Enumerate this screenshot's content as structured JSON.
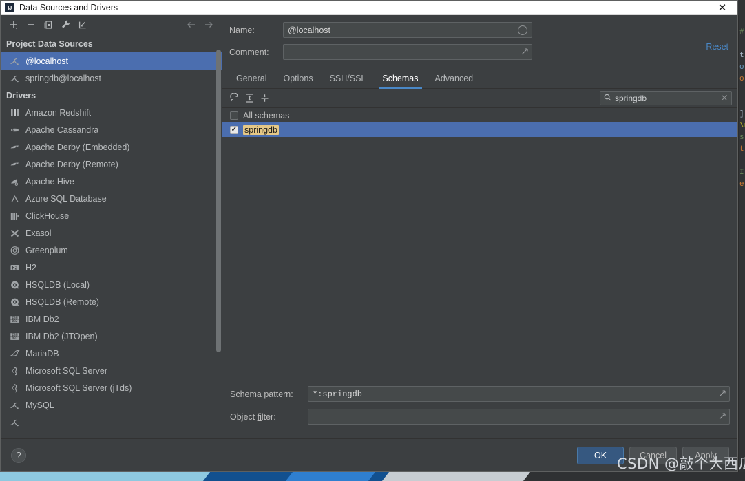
{
  "window": {
    "title": "Data Sources and Drivers",
    "app_icon": "intellij-idea-icon",
    "close_label": "✕"
  },
  "left_panel": {
    "toolbar": [
      {
        "name": "add-data-source-button",
        "icon": "plus-icon",
        "label": "+"
      },
      {
        "name": "remove-data-source-button",
        "icon": "minus-icon",
        "label": "−"
      },
      {
        "name": "duplicate-data-source-button",
        "icon": "copy-icon",
        "label": "Duplicate"
      },
      {
        "name": "properties-button",
        "icon": "wrench-icon",
        "label": "Properties"
      },
      {
        "name": "import-button",
        "icon": "import-arrow-icon",
        "label": "Import"
      },
      {
        "name": "navigate-back-button",
        "icon": "arrow-left-icon",
        "label": "←"
      },
      {
        "name": "navigate-forward-button",
        "icon": "arrow-right-icon",
        "label": "→"
      }
    ],
    "groups": [
      {
        "title": "Project Data Sources",
        "items": [
          {
            "label": "@localhost",
            "icon": "mysql-icon",
            "selected": true
          },
          {
            "label": "springdb@localhost",
            "icon": "mysql-icon",
            "selected": false
          }
        ]
      },
      {
        "title": "Drivers",
        "items": [
          {
            "label": "Amazon Redshift",
            "icon": "redshift-icon",
            "selected": false
          },
          {
            "label": "Apache Cassandra",
            "icon": "cassandra-icon",
            "selected": false
          },
          {
            "label": "Apache Derby (Embedded)",
            "icon": "derby-icon",
            "selected": false
          },
          {
            "label": "Apache Derby (Remote)",
            "icon": "derby-icon",
            "selected": false
          },
          {
            "label": "Apache Hive",
            "icon": "hive-icon",
            "selected": false
          },
          {
            "label": "Azure SQL Database",
            "icon": "azure-icon",
            "selected": false
          },
          {
            "label": "ClickHouse",
            "icon": "clickhouse-icon",
            "selected": false
          },
          {
            "label": "Exasol",
            "icon": "exasol-icon",
            "selected": false
          },
          {
            "label": "Greenplum",
            "icon": "greenplum-icon",
            "selected": false
          },
          {
            "label": "H2",
            "icon": "h2-icon",
            "selected": false
          },
          {
            "label": "HSQLDB (Local)",
            "icon": "hsqldb-icon",
            "selected": false
          },
          {
            "label": "HSQLDB (Remote)",
            "icon": "hsqldb-icon",
            "selected": false
          },
          {
            "label": "IBM Db2",
            "icon": "db2-icon",
            "selected": false
          },
          {
            "label": "IBM Db2 (JTOpen)",
            "icon": "db2-icon",
            "selected": false
          },
          {
            "label": "MariaDB",
            "icon": "mariadb-icon",
            "selected": false
          },
          {
            "label": "Microsoft SQL Server",
            "icon": "mssql-icon",
            "selected": false
          },
          {
            "label": "Microsoft SQL Server (jTds)",
            "icon": "mssql-icon",
            "selected": false
          },
          {
            "label": "MySQL",
            "icon": "mysql-icon",
            "selected": false
          },
          {
            "label": "",
            "icon": "mysql-icon",
            "selected": false
          }
        ]
      }
    ]
  },
  "detail": {
    "name_label": "Name:",
    "name_value": "@localhost",
    "name_placeholder": "",
    "comment_label": "Comment:",
    "comment_value": "",
    "comment_placeholder": "",
    "reset_label": "Reset",
    "tabs": [
      {
        "label": "General",
        "active": false
      },
      {
        "label": "Options",
        "active": false
      },
      {
        "label": "SSH/SSL",
        "active": false
      },
      {
        "label": "Schemas",
        "active": true
      },
      {
        "label": "Advanced",
        "active": false
      }
    ]
  },
  "schemas_tab": {
    "toolbar": [
      {
        "name": "refresh-schemas-button",
        "icon": "refresh-icon"
      },
      {
        "name": "expand-all-button",
        "icon": "expand-all-icon"
      },
      {
        "name": "collapse-all-button",
        "icon": "collapse-all-icon"
      }
    ],
    "search": {
      "icon": "search-icon",
      "value": "springdb",
      "placeholder": "Search",
      "clear_icon": "close-icon"
    },
    "rows": [
      {
        "label": "All schemas",
        "checked": false,
        "selected": false,
        "match": false
      },
      {
        "label": "springdb",
        "checked": true,
        "selected": true,
        "match": true
      }
    ],
    "schema_pattern_label_pre": "Schema ",
    "schema_pattern_label_mn": "p",
    "schema_pattern_label_post": "attern:",
    "schema_pattern_value": "*:springdb",
    "object_filter_label_pre": "Object ",
    "object_filter_label_mn": "fi",
    "object_filter_label_post": "lter:",
    "object_filter_value": "",
    "expand_icon": "expand-arrow-icon"
  },
  "footer": {
    "help_label": "?",
    "buttons": [
      {
        "label": "OK",
        "name": "ok-button",
        "primary": true
      },
      {
        "label": "Cancel",
        "name": "cancel-button",
        "primary": false
      },
      {
        "label": "Apply",
        "name": "apply-button",
        "primary": false
      }
    ]
  },
  "watermark": {
    "text": "CSDN @敲个大西瓜"
  },
  "colors": {
    "accent": "#4a88c7",
    "selection": "#4b6eaf",
    "primary_button": "#365880",
    "match_highlight": "#e5c887",
    "panel_bg": "#3c3f41"
  },
  "ide_background": {
    "lines": [
      "",
      "",
      "t",
      "o",
      "o",
      "",
      "",
      "]",
      "项",
      "s",
      "t",
      "",
      "I",
      "e"
    ]
  }
}
